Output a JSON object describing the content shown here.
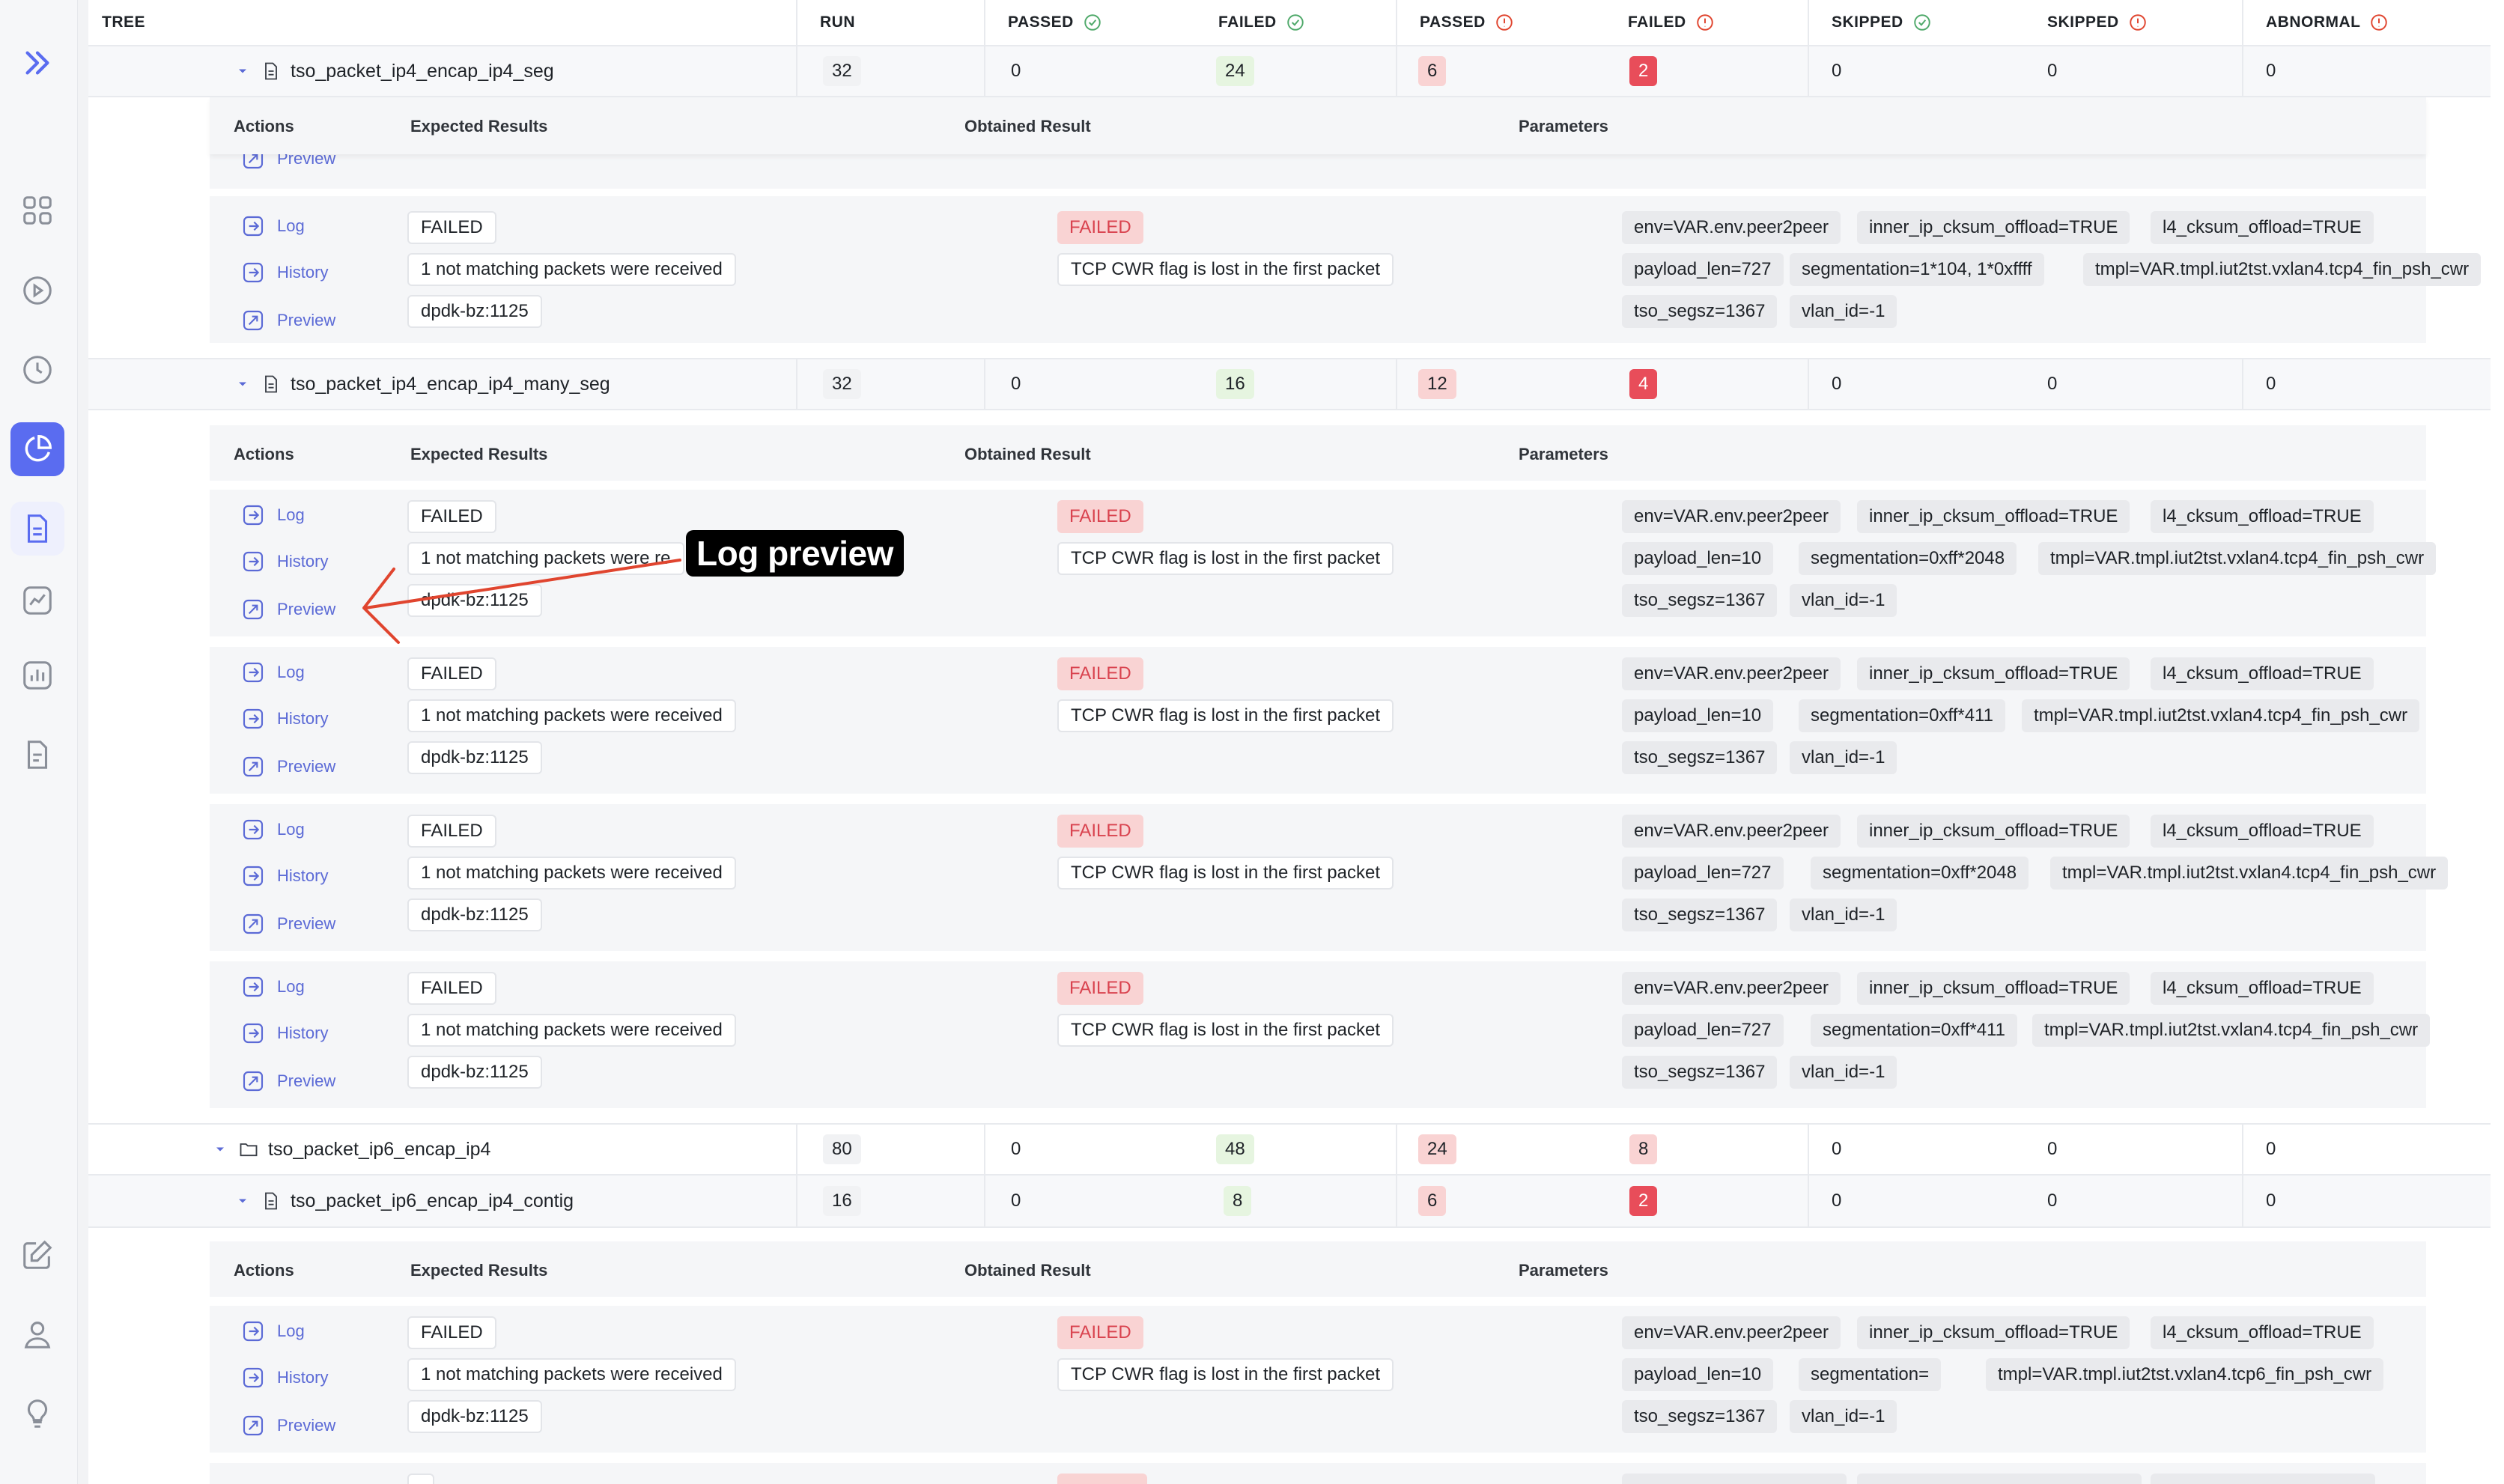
{
  "columns": {
    "tree": "TREE",
    "run": "RUN",
    "passed_expected": "PASSED",
    "failed_expected": "FAILED",
    "passed_unexpected": "PASSED",
    "failed_unexpected": "FAILED",
    "skipped_expected": "SKIPPED",
    "skipped_unexpected": "SKIPPED",
    "abnormal": "ABNORMAL"
  },
  "panel_headers": {
    "actions": "Actions",
    "expected": "Expected Results",
    "obtained": "Obtained Result",
    "parameters": "Parameters"
  },
  "actions": {
    "log": "Log",
    "history": "History",
    "preview": "Preview"
  },
  "rows": {
    "r1": {
      "name": "tso_packet_ip4_encap_ip4_seg",
      "run": "32",
      "passed_exp": "0",
      "failed_exp": "24",
      "passed_unexp": "6",
      "failed_unexp": "2",
      "skipped_exp": "0",
      "skipped_unexp": "0",
      "abnormal": "0"
    },
    "r2": {
      "name": "tso_packet_ip4_encap_ip4_many_seg",
      "run": "32",
      "passed_exp": "0",
      "failed_exp": "16",
      "passed_unexp": "12",
      "failed_unexp": "4",
      "skipped_exp": "0",
      "skipped_unexp": "0",
      "abnormal": "0"
    },
    "r3": {
      "name": "tso_packet_ip6_encap_ip4",
      "run": "80",
      "passed_exp": "0",
      "failed_exp": "48",
      "passed_unexp": "24",
      "failed_unexp": "8",
      "skipped_exp": "0",
      "skipped_unexp": "0",
      "abnormal": "0"
    },
    "r4": {
      "name": "tso_packet_ip6_encap_ip4_contig",
      "run": "16",
      "passed_exp": "0",
      "failed_exp": "8",
      "passed_unexp": "6",
      "failed_unexp": "2",
      "skipped_exp": "0",
      "skipped_unexp": "0",
      "abnormal": "0"
    }
  },
  "results": {
    "expected_status": "FAILED",
    "expected_verdict": "1 not matching packets were received",
    "expected_verdict_cut": "1 not matching packets were re",
    "expected_key": "dpdk-bz:1125",
    "obtained_status": "FAILED",
    "obtained_verdict": "TCP CWR flag is lost in the first packet"
  },
  "params": {
    "env": "env=VAR.env.peer2peer",
    "inner": "inner_ip_cksum_offload=TRUE",
    "l4": "l4_cksum_offload=TRUE",
    "tso": "tso_segsz=1367",
    "vlan": "vlan_id=-1",
    "p727": "payload_len=727",
    "p10": "payload_len=10",
    "seg_104": "segmentation=1*104, 1*0xffff",
    "seg_2048": "segmentation=0xff*2048",
    "seg_411": "segmentation=0xff*411",
    "seg_empty": "segmentation=",
    "tmpl_ip4": "tmpl=VAR.tmpl.iut2tst.vxlan4.tcp4_fin_psh_cwr",
    "tmpl_ip6": "tmpl=VAR.tmpl.iut2tst.vxlan4.tcp6_fin_psh_cwr"
  },
  "annotation": {
    "label": "Log preview"
  },
  "colors": {
    "accent": "#5a6cf0",
    "failed_red": "#e84d5a",
    "failed_pink": "#f9d3d3",
    "green": "#e6f5e0",
    "link": "#5b6ad6",
    "arrow": "#e0452f"
  },
  "icons": [
    "expand-icon",
    "dashboard-icon",
    "play-icon",
    "clock-icon",
    "pie-chart-icon",
    "document-icon",
    "trend-icon",
    "bar-chart-icon",
    "report-icon",
    "edit-icon",
    "user-icon",
    "bulb-icon",
    "check-circle-icon",
    "alert-circle-icon",
    "log-icon",
    "history-icon",
    "preview-icon",
    "file-icon",
    "folder-icon",
    "chevron-down-icon"
  ]
}
